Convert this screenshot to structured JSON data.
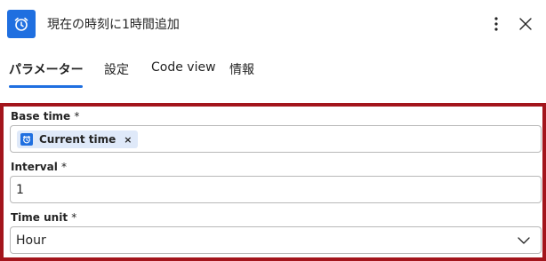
{
  "header": {
    "title": "現在の時刻に1時間追加",
    "app_icon": "alarm-clock-icon",
    "more_icon": "more-vertical-icon",
    "close_icon": "close-icon"
  },
  "tabs": [
    {
      "label": "パラメーター",
      "active": true
    },
    {
      "label": "設定",
      "active": false
    },
    {
      "label": "Code view",
      "active": false
    },
    {
      "label": "情報",
      "active": false
    }
  ],
  "fields": {
    "base_time": {
      "label": "Base time",
      "required_mark": "*",
      "token": {
        "label": "Current time",
        "icon": "alarm-clock-icon",
        "remove": "×"
      }
    },
    "interval": {
      "label": "Interval",
      "required_mark": "*",
      "value": "1"
    },
    "time_unit": {
      "label": "Time unit",
      "required_mark": "*",
      "value": "Hour",
      "icon": "chevron-down-icon"
    }
  },
  "colors": {
    "accent": "#1f6fe0",
    "highlight_frame": "#a3151c",
    "token_bg": "#dfe9f9"
  }
}
